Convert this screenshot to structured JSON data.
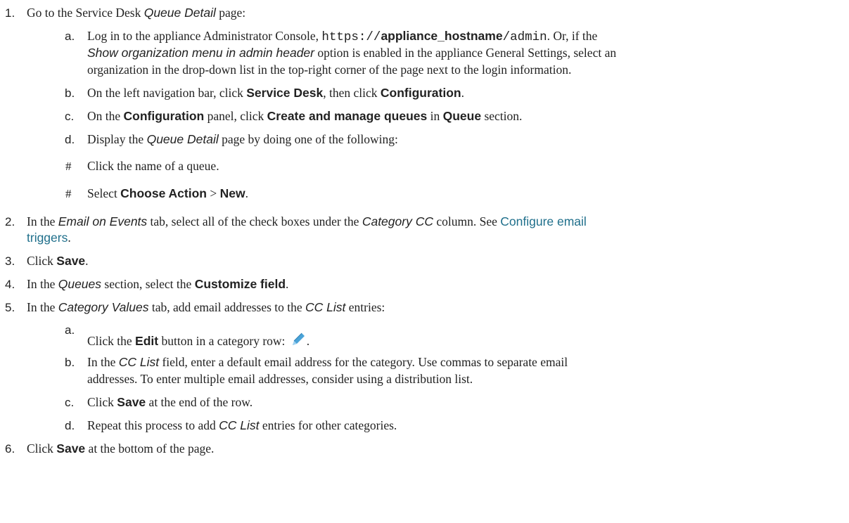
{
  "steps": {
    "s1": {
      "num": "1.",
      "pre": "Go to the Service Desk ",
      "page": "Queue Detail",
      "post": " page:",
      "a": {
        "letter": "a.",
        "t1": "Log in to the appliance Administrator Console, ",
        "url1": "https://",
        "url_host": "appliance_hostname",
        "url2": "/admin",
        "t2": ". Or, if the",
        "option": "Show organization menu in admin header",
        "t3": " option is enabled in the appliance General Settings, select an",
        "t4": "organization in the drop-down list in the top-right corner of the page next to the login information."
      },
      "b": {
        "letter": "b.",
        "t1": "On the left navigation bar, click ",
        "k1": "Service Desk",
        "t2": ", then click ",
        "k2": "Configuration",
        "t3": "."
      },
      "c": {
        "letter": "c.",
        "t1": "On the ",
        "k1": "Configuration",
        "t2": " panel, click ",
        "k2": "Create and manage queues",
        "t3": " in ",
        "k3": "Queue",
        "t4": " section."
      },
      "d": {
        "letter": "d.",
        "t1": "Display the ",
        "page": "Queue Detail",
        "t2": " page by doing one of the following:"
      },
      "h1": {
        "mark": "#",
        "text": "Click the name of a queue."
      },
      "h2": {
        "mark": "#",
        "t1": "Select ",
        "k1": "Choose Action",
        "t2": " > ",
        "k2": "New",
        "t3": "."
      }
    },
    "s2": {
      "num": "2.",
      "t1": "In the ",
      "tab": "Email on Events",
      "t2": " tab, select all of the check boxes under the ",
      "col": "Category CC",
      "t3": " column. See ",
      "link1": "Configure email",
      "link2": "triggers",
      "t4": "."
    },
    "s3": {
      "num": "3.",
      "t1": "Click ",
      "k1": "Save",
      "t2": "."
    },
    "s4": {
      "num": "4.",
      "t1": "In the ",
      "sec": "Queues",
      "t2": " section, select the ",
      "k1": "Customize field",
      "t3": "."
    },
    "s5": {
      "num": "5.",
      "t1": "In the ",
      "tab": "Category Values",
      "t2": " tab, add email addresses to the ",
      "field": "CC List",
      "t3": " entries:",
      "a": {
        "letter": "a.",
        "t1": "Click the ",
        "k1": "Edit",
        "t2": " button in a category row: ",
        "icon": "pencil-icon",
        "t3": "."
      },
      "b": {
        "letter": "b.",
        "t1": "In the ",
        "field": "CC List",
        "t2": " field, enter a default email address for the category. Use commas to separate email",
        "t3": "addresses. To enter multiple email addresses, consider using a distribution list."
      },
      "c": {
        "letter": "c.",
        "t1": "Click ",
        "k1": "Save",
        "t2": " at the end of the row."
      },
      "d": {
        "letter": "d.",
        "t1": "Repeat this process to add ",
        "field": "CC List",
        "t2": " entries for other categories."
      }
    },
    "s6": {
      "num": "6.",
      "t1": "Click ",
      "k1": "Save",
      "t2": " at the bottom of the page."
    }
  },
  "colors": {
    "text": "#222222",
    "link": "#1f6f8b",
    "pencil": "#4aa3d8"
  }
}
